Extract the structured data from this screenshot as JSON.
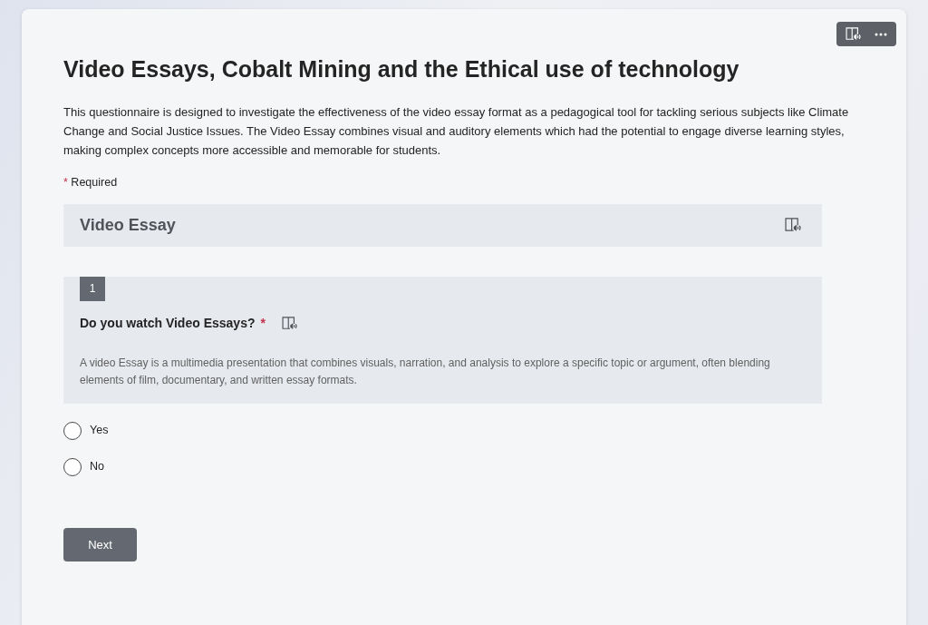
{
  "form": {
    "title": "Video Essays, Cobalt Mining and the Ethical use of technology",
    "description": "This questionnaire is designed to investigate the effectiveness of the video essay format as a pedagogical tool for tackling serious subjects like Climate Change and Social Justice Issues. The Video Essay combines visual and auditory elements which had the potential to engage diverse learning styles, making complex concepts more accessible and memorable for students.",
    "required_mark": "*",
    "required_label": "Required"
  },
  "section": {
    "title": "Video Essay"
  },
  "question": {
    "number": "1",
    "text": "Do you watch Video Essays?",
    "required_mark": "*",
    "description": "A video Essay is a multimedia presentation that combines visuals, narration, and analysis to explore a specific topic or argument, often blending elements of film, documentary, and written essay formats.",
    "options": [
      {
        "label": "Yes",
        "selected": false
      },
      {
        "label": "No",
        "selected": false
      }
    ]
  },
  "buttons": [
    "Next"
  ]
}
